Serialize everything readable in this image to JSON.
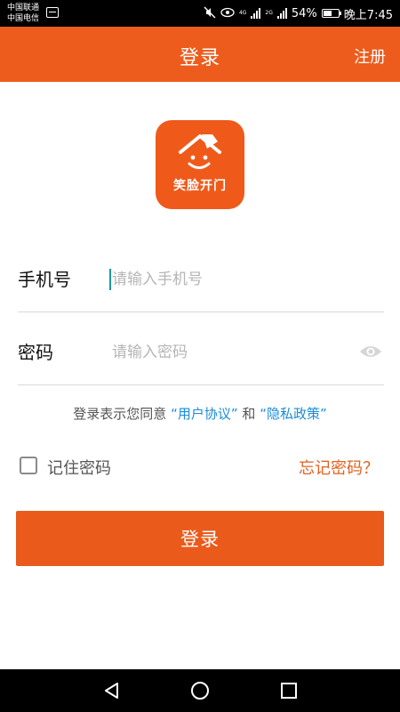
{
  "status_bar": {
    "carrier_1": "中国联通",
    "carrier_2": "中国电信",
    "net_1": "4G",
    "net_2": "2G",
    "battery": "54%",
    "time": "晚上7:45"
  },
  "header": {
    "title": "登录",
    "register_label": "注册"
  },
  "logo": {
    "text": "笑脸开门"
  },
  "form": {
    "phone": {
      "label": "手机号",
      "placeholder": "请输入手机号",
      "value": ""
    },
    "password": {
      "label": "密码",
      "placeholder": "请输入密码",
      "value": ""
    }
  },
  "agreement": {
    "prefix": "登录表示您同意",
    "user_agreement": "“用户协议”",
    "conjunction": "和",
    "privacy_policy": "“隐私政策”"
  },
  "remember": {
    "label": "记住密码",
    "checked": false
  },
  "forgot_label": "忘记密码？",
  "login_button_label": "登录",
  "colors": {
    "brand": "#ed5c1c",
    "link": "#1a8cd8",
    "forgot": "#e2621f"
  },
  "icons": {
    "eye": "eye-icon",
    "back": "nav-back-icon",
    "home": "nav-home-icon",
    "recent": "nav-recent-icon"
  }
}
